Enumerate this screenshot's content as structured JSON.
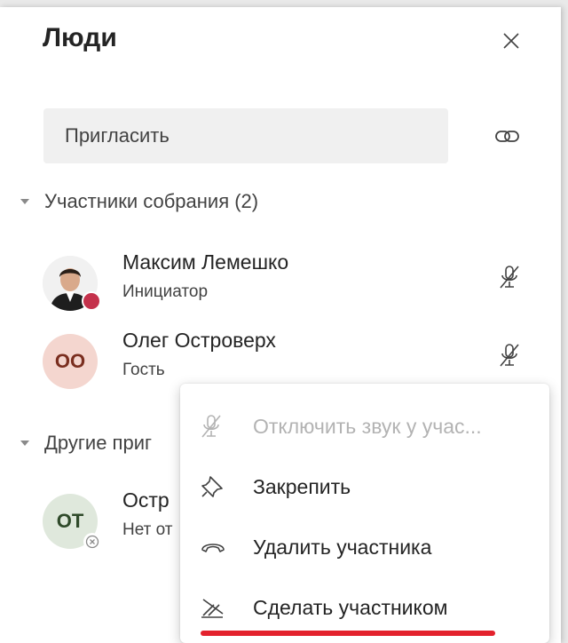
{
  "panel": {
    "title": "Люди",
    "invite_placeholder": "Пригласить"
  },
  "sections": [
    {
      "label": "Участники собрания (2)",
      "people": [
        {
          "name": "Максим Лемешко",
          "role": "Инициатор",
          "avatar": "photo",
          "presence": "busy"
        },
        {
          "name": "Олег Островерх",
          "role": "Гость",
          "initials": "ОО"
        }
      ]
    },
    {
      "label": "Другие приг",
      "people": [
        {
          "name": "Остр",
          "role": "Нет от",
          "initials": "ОТ",
          "presence": "offline"
        }
      ]
    }
  ],
  "context_menu": {
    "items": [
      {
        "label": "Отключить звук у учас...",
        "icon": "mic-off-icon",
        "disabled": true
      },
      {
        "label": "Закрепить",
        "icon": "pin-icon",
        "disabled": false
      },
      {
        "label": "Удалить участника",
        "icon": "remove-person-icon",
        "disabled": false
      },
      {
        "label": "Сделать участником",
        "icon": "make-attendee-icon",
        "disabled": false
      }
    ]
  },
  "colors": {
    "presence_busy": "#c4314b",
    "avatar_oo_bg": "#f4d6cf",
    "avatar_oo_fg": "#7a2e1f",
    "avatar_ot_bg": "#dfe8dc",
    "avatar_ot_fg": "#2f4a2a",
    "highlight_underline": "#e3222d"
  }
}
